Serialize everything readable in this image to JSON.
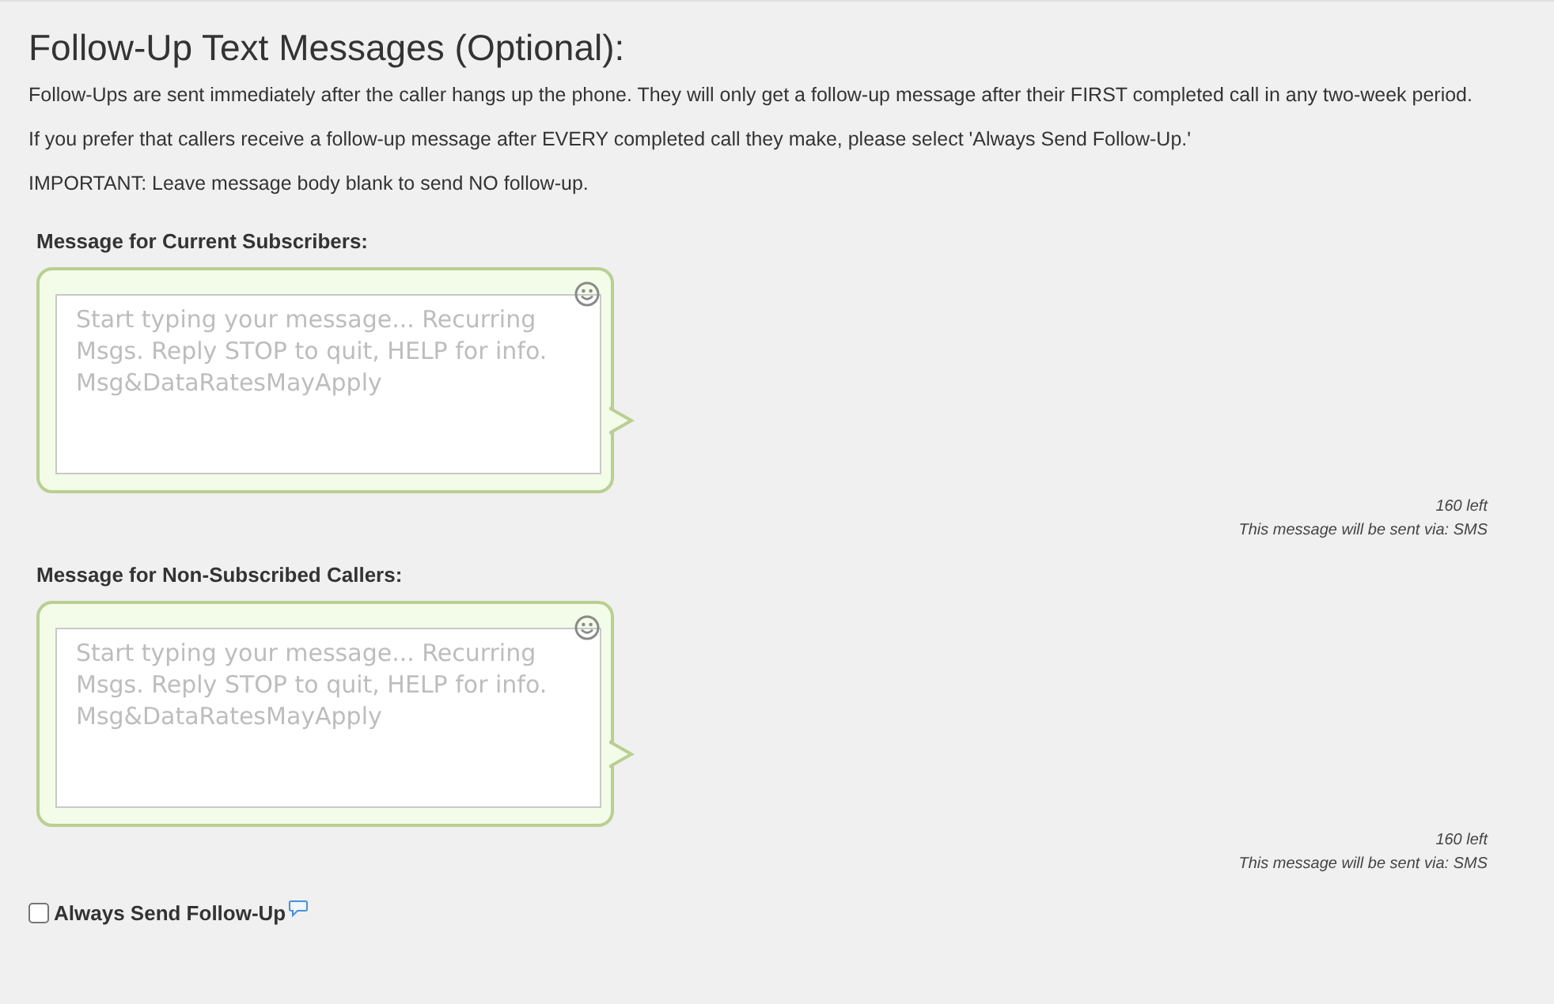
{
  "title": "Follow-Up Text Messages (Optional):",
  "paragraphs": [
    "Follow-Ups are sent immediately after the caller hangs up the phone. They will only get a follow-up message after their FIRST completed call in any two-week period.",
    "If you prefer that callers receive a follow-up message after EVERY completed call they make, please select 'Always Send Follow-Up.'",
    "IMPORTANT: Leave message body blank to send NO follow-up."
  ],
  "messages": [
    {
      "label": "Message for Current Subscribers:",
      "placeholder": "Start typing your message... Recurring Msgs. Reply STOP to quit, HELP for info. Msg&DataRatesMayApply",
      "remaining": "160 left",
      "via": "This message will be sent via: SMS"
    },
    {
      "label": "Message for Non-Subscribed Callers:",
      "placeholder": "Start typing your message... Recurring Msgs. Reply STOP to quit, HELP for info. Msg&DataRatesMayApply",
      "remaining": "160 left",
      "via": "This message will be sent via: SMS"
    }
  ],
  "always_send": {
    "label": "Always Send Follow-Up",
    "checked": false
  }
}
